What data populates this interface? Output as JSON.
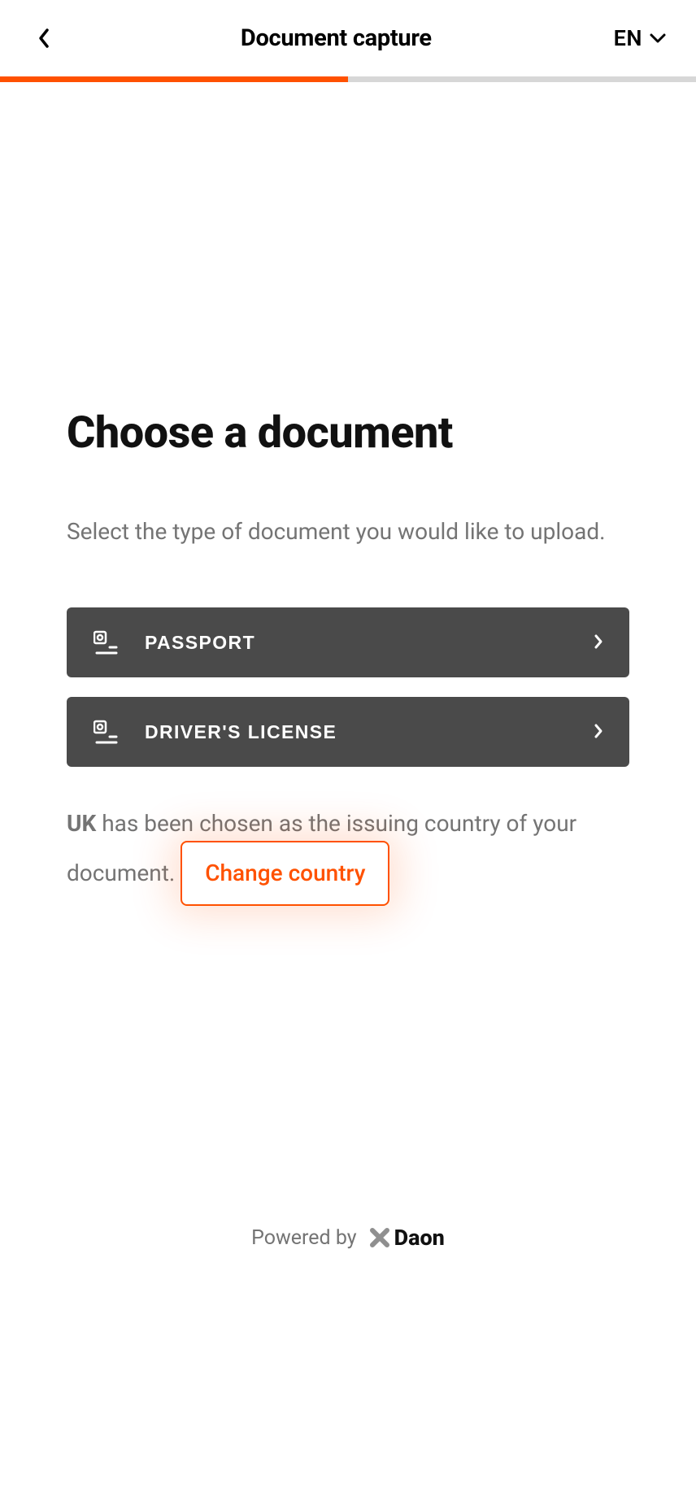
{
  "header": {
    "title": "Document capture",
    "language": "EN"
  },
  "progress": {
    "percent": 50,
    "accent": "#ff5100"
  },
  "main": {
    "title": "Choose a document",
    "subtitle": "Select the type of document you would like to upload.",
    "options": [
      {
        "label": "PASSPORT"
      },
      {
        "label": "DRIVER'S LICENSE"
      }
    ],
    "country": {
      "name": "UK",
      "text_mid": " has been chosen as the issuing country of your document. ",
      "change_link": "Change country"
    }
  },
  "footer": {
    "powered": "Powered by",
    "brand": "Daon"
  }
}
